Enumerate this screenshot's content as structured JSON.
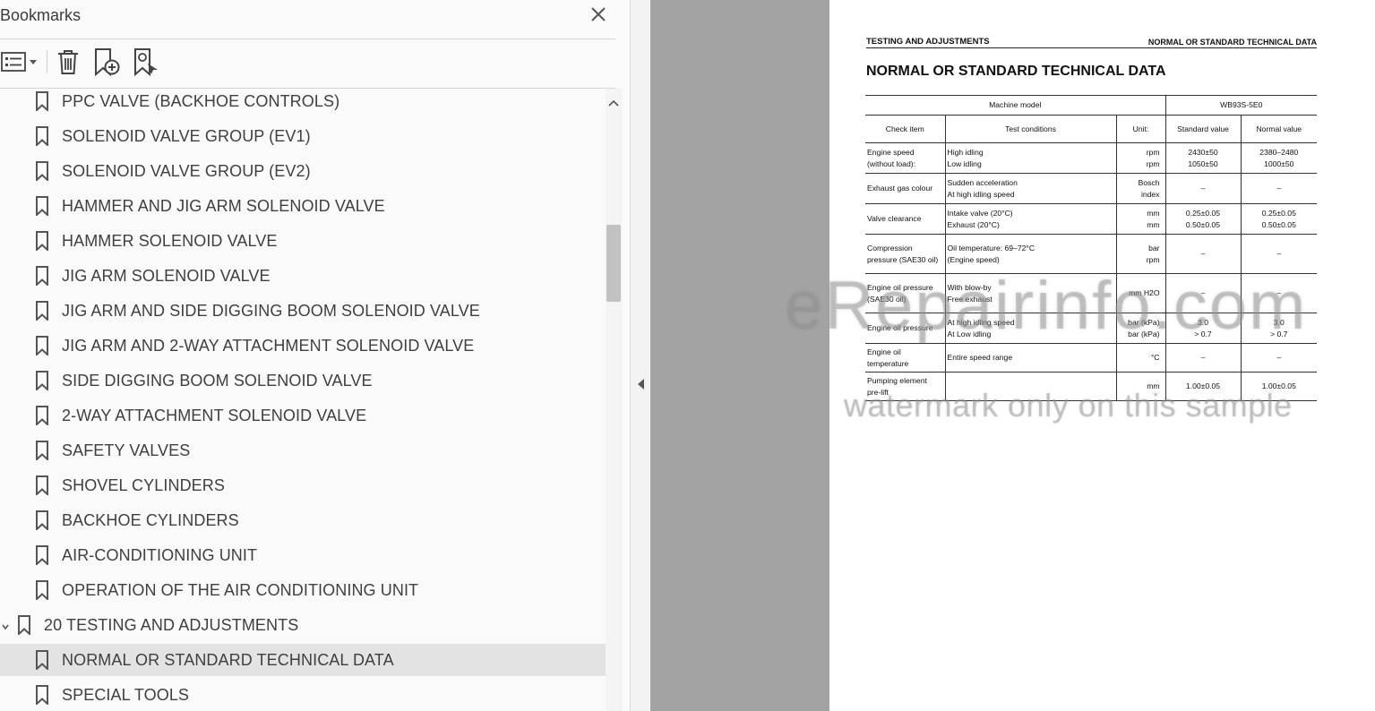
{
  "panel": {
    "title": "Bookmarks",
    "items": [
      {
        "label": "PPC VALVE (BACKHOE CONTROLS)",
        "level": 1
      },
      {
        "label": "SOLENOID VALVE GROUP (EV1)",
        "level": 1
      },
      {
        "label": "SOLENOID VALVE GROUP (EV2)",
        "level": 1
      },
      {
        "label": "HAMMER AND JIG ARM SOLENOID VALVE",
        "level": 1
      },
      {
        "label": "HAMMER SOLENOID VALVE",
        "level": 1
      },
      {
        "label": "JIG ARM SOLENOID VALVE",
        "level": 1
      },
      {
        "label": "JIG ARM AND SIDE DIGGING BOOM SOLENOID VALVE",
        "level": 1
      },
      {
        "label": "JIG ARM AND 2-WAY ATTACHMENT SOLENOID VALVE",
        "level": 1
      },
      {
        "label": "SIDE DIGGING BOOM SOLENOID VALVE",
        "level": 1
      },
      {
        "label": "2-WAY ATTACHMENT SOLENOID VALVE",
        "level": 1
      },
      {
        "label": "SAFETY VALVES",
        "level": 1
      },
      {
        "label": "SHOVEL CYLINDERS",
        "level": 1
      },
      {
        "label": "BACKHOE CYLINDERS",
        "level": 1
      },
      {
        "label": "AIR-CONDITIONING UNIT",
        "level": 1
      },
      {
        "label": "OPERATION OF THE AIR CONDITIONING UNIT",
        "level": 1
      },
      {
        "label": "20 TESTING AND ADJUSTMENTS",
        "level": 0,
        "expanded": true
      },
      {
        "label": "NORMAL OR STANDARD TECHNICAL DATA",
        "level": 1,
        "selected": true
      },
      {
        "label": "SPECIAL TOOLS",
        "level": 1
      }
    ]
  },
  "doc": {
    "header_left": "TESTING AND ADJUSTMENTS",
    "header_right": "NORMAL OR STANDARD TECHNICAL DATA",
    "title": "NORMAL OR STANDARD TECHNICAL DATA",
    "table": {
      "machine_model_label": "Machine model",
      "machine_model": "WB93S-5E0",
      "col_check": "Check item",
      "col_cond": "Test conditions",
      "col_unit": "Unit:",
      "col_std": "Standard value",
      "col_norm": "Normal value",
      "rows": [
        {
          "item": "Engine speed (without load):",
          "cond": [
            "High idling",
            "Low idling"
          ],
          "unit": [
            "rpm",
            "rpm"
          ],
          "std": [
            "2430±50",
            "1050±50"
          ],
          "norm": [
            "2380–2480",
            "1000±50"
          ]
        },
        {
          "item": "Exhaust gas colour",
          "cond": [
            "Sudden acceleration",
            "At high idling speed"
          ],
          "unit": [
            "Bosch",
            "index"
          ],
          "std": [
            "–"
          ],
          "norm": [
            "–"
          ]
        },
        {
          "item": "Valve clearance",
          "cond": [
            "Intake valve (20°C)",
            "Exhaust (20°C)"
          ],
          "unit": [
            "mm",
            "mm"
          ],
          "std": [
            "0.25±0.05",
            "0.50±0.05"
          ],
          "norm": [
            "0.25±0.05",
            "0.50±0.05"
          ]
        },
        {
          "item": "Compression pressure (SAE30 oil)",
          "cond": [
            "Oil temperature: 69–72°C",
            "(Engine speed)"
          ],
          "unit": [
            "bar",
            "rpm"
          ],
          "std": [
            "–"
          ],
          "norm": [
            "–"
          ]
        },
        {
          "item": "Engine oil pressure (SAE30 oil)",
          "cond": [
            "With blow-by",
            "Free exhaust"
          ],
          "unit": [
            "mm H2O"
          ],
          "std": [
            "–"
          ],
          "norm": [
            "–"
          ]
        },
        {
          "item": "Engine oil pressure",
          "cond": [
            "At high idling speed",
            "At Low idling"
          ],
          "unit": [
            "bar (kPa)",
            "bar (kPa)"
          ],
          "std": [
            "3.0",
            "> 0.7"
          ],
          "norm": [
            "3.0",
            "> 0.7"
          ]
        },
        {
          "item": "Engine oil temperature",
          "cond": [
            "Entire speed range"
          ],
          "unit": [
            "°C"
          ],
          "std": [
            "–"
          ],
          "norm": [
            "–"
          ]
        },
        {
          "item": "Pumping element pre-lift",
          "cond": [
            ""
          ],
          "unit": [
            "mm"
          ],
          "std": [
            "1.00±0.05"
          ],
          "norm": [
            "1.00±0.05"
          ]
        }
      ]
    }
  },
  "watermark": {
    "line1": "eRepairinfo.com",
    "line2": "watermark only on this sample"
  }
}
